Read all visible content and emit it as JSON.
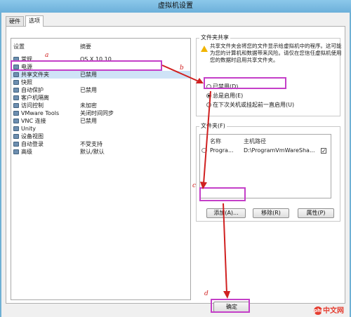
{
  "window": {
    "title": "虚拟机设置"
  },
  "tabs": [
    "硬件",
    "选项"
  ],
  "settings_list": {
    "header": {
      "setting": "设置",
      "summary": "摘要"
    },
    "items": [
      {
        "label": "常规",
        "value": "OS X 10.10",
        "icon": "gear-icon"
      },
      {
        "label": "电源",
        "value": "",
        "icon": "power-icon"
      },
      {
        "label": "共享文件夹",
        "value": "已禁用",
        "icon": "folder-icon",
        "selected": true
      },
      {
        "label": "快照",
        "value": "",
        "icon": "camera-icon"
      },
      {
        "label": "自动保护",
        "value": "已禁用",
        "icon": "shield-icon"
      },
      {
        "label": "客户机隔离",
        "value": "",
        "icon": "isolation-icon"
      },
      {
        "label": "访问控制",
        "value": "未加密",
        "icon": "lock-icon"
      },
      {
        "label": "VMware Tools",
        "value": "关闭时间同步",
        "icon": "tools-icon"
      },
      {
        "label": "VNC 连接",
        "value": "已禁用",
        "icon": "vnc-icon"
      },
      {
        "label": "Unity",
        "value": "",
        "icon": "unity-icon"
      },
      {
        "label": "设备视图",
        "value": "",
        "icon": "device-icon"
      },
      {
        "label": "自动登录",
        "value": "不受支持",
        "icon": "login-icon"
      },
      {
        "label": "高级",
        "value": "默认/默认",
        "icon": "advanced-icon"
      }
    ]
  },
  "folder_sharing": {
    "title": "文件夹共享",
    "warning": "共享文件夹会将您的文件显示给虚拟机中的程序。这可能为您的计算机和数据带来风险。请仅在您信任虚拟机使用您的数据时启用共享文件夹。",
    "options": [
      "已禁用(D)",
      "总是启用(E)",
      "在下次关机或挂起前一直启用(U)"
    ],
    "selected_option": 1
  },
  "folders": {
    "title": "文件夹(F)",
    "columns": [
      "名称",
      "主机路径"
    ],
    "rows": [
      {
        "name": "Progra...",
        "path": "D:\\ProgramVmWareSha...",
        "checked": true
      }
    ],
    "buttons": {
      "add": "添加(A)...",
      "remove": "移除(R)",
      "properties": "属性(P)"
    }
  },
  "footer": {
    "ok": "确定"
  },
  "annotations": [
    "a",
    "b",
    "c",
    "d"
  ],
  "watermark": {
    "logo": "php",
    "text": "中文网"
  },
  "colors": {
    "highlight": "#c43fc8",
    "arrow": "#d02020",
    "watermark": "#e53d30"
  }
}
